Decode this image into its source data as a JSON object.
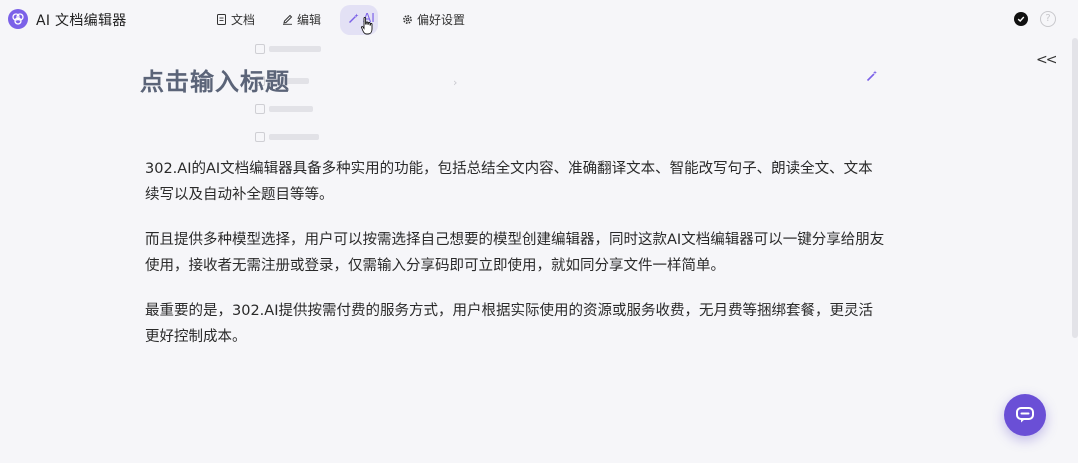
{
  "app": {
    "title": "AI 文档编辑器"
  },
  "menu": {
    "items": [
      {
        "label": "文档",
        "icon": "document-icon"
      },
      {
        "label": "编辑",
        "icon": "pencil-icon"
      },
      {
        "label": "AI",
        "icon": "magic-wand-icon",
        "active": true
      },
      {
        "label": "偏好设置",
        "icon": "gear-icon"
      }
    ]
  },
  "help": {
    "glyph": "?"
  },
  "sidebar_toggle": {
    "glyph": "<<"
  },
  "document": {
    "title": "点击输入标题",
    "paragraphs": [
      "302.AI的AI文档编辑器具备多种实用的功能，包括总结全文内容、准确翻译文本、智能改写句子、朗读全文、文本续写以及自动补全题目等等。",
      "而且提供多种模型选择，用户可以按需选择自己想要的模型创建编辑器，同时这款AI文档编辑器可以一键分享给朋友使用，接收者无需注册或登录，仅需输入分享码即可立即使用，就如同分享文件一样简单。",
      "最重要的是，302.AI提供按需付费的服务方式，用户根据实际使用的资源或服务收费，无月费等捆绑套餐，更灵活更好控制成本。"
    ]
  },
  "colors": {
    "accent": "#7b61e8",
    "fab": "#6a4fd6",
    "title": "#5b6478",
    "background": "#f6f6f9"
  }
}
